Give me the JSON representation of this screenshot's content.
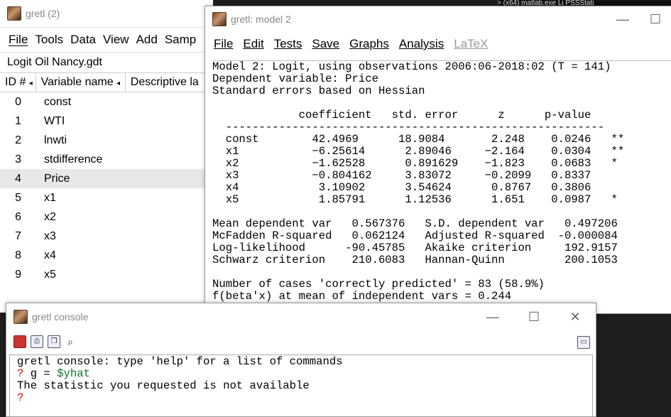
{
  "topstrip": "> (x64)   matlab.exe     Li PSSStati",
  "main_window": {
    "title": "gretl (2)",
    "menu": [
      "File",
      "Tools",
      "Data",
      "View",
      "Add",
      "Samp"
    ],
    "dataset": "Logit Oil Nancy.gdt",
    "columns": [
      "ID #",
      "Variable name",
      "Descriptive la"
    ],
    "variables": [
      {
        "id": "0",
        "name": "const"
      },
      {
        "id": "1",
        "name": "WTI"
      },
      {
        "id": "2",
        "name": "lnwti"
      },
      {
        "id": "3",
        "name": "stdifference"
      },
      {
        "id": "4",
        "name": "Price"
      },
      {
        "id": "5",
        "name": "x1"
      },
      {
        "id": "6",
        "name": "x2"
      },
      {
        "id": "7",
        "name": "x3"
      },
      {
        "id": "8",
        "name": "x4"
      },
      {
        "id": "9",
        "name": "x5"
      }
    ],
    "selected_id": "4"
  },
  "model_window": {
    "title": "gretl: model 2",
    "menu": [
      "File",
      "Edit",
      "Tests",
      "Save",
      "Graphs",
      "Analysis",
      "LaTeX"
    ],
    "disabled_menu": "LaTeX",
    "output_lines": [
      "Model 2: Logit, using observations 2006:06-2018:02 (T = 141)",
      "Dependent variable: Price",
      "Standard errors based on Hessian",
      "",
      "             coefficient   std. error      z      p-value",
      "  ---------------------------------------------------------",
      "  const        42.4969      18.9084       2.248    0.0246   **",
      "  x1           −6.25614      2.89046     −2.164    0.0304   **",
      "  x2           −1.62528      0.891629    −1.823    0.0683   *",
      "  x3           −0.804162     3.83072     −0.2099   0.8337",
      "  x4            3.10902      3.54624      0.8767   0.3806",
      "  x5            1.85791      1.12536      1.651    0.0987   *",
      "",
      "Mean dependent var   0.567376   S.D. dependent var   0.497206",
      "McFadden R-squared   0.062124   Adjusted R-squared  -0.000084",
      "Log-likelihood      -90.45785   Akaike criterion     192.9157",
      "Schwarz criterion    210.6083   Hannan-Quinn         200.1053",
      "",
      "Number of cases 'correctly predicted' = 83 (58.9%)",
      "f(beta'x) at mean of independent vars = 0.244"
    ]
  },
  "console_window": {
    "title": "gretl console",
    "banner": "gretl console: type 'help' for a list of commands",
    "prompt": "?",
    "command_prefix": " g = ",
    "command_var": "$yhat",
    "message": "The statistic you requested is not available"
  },
  "window_controls": {
    "minimize": "—",
    "maximize": "☐",
    "close": "✕"
  }
}
